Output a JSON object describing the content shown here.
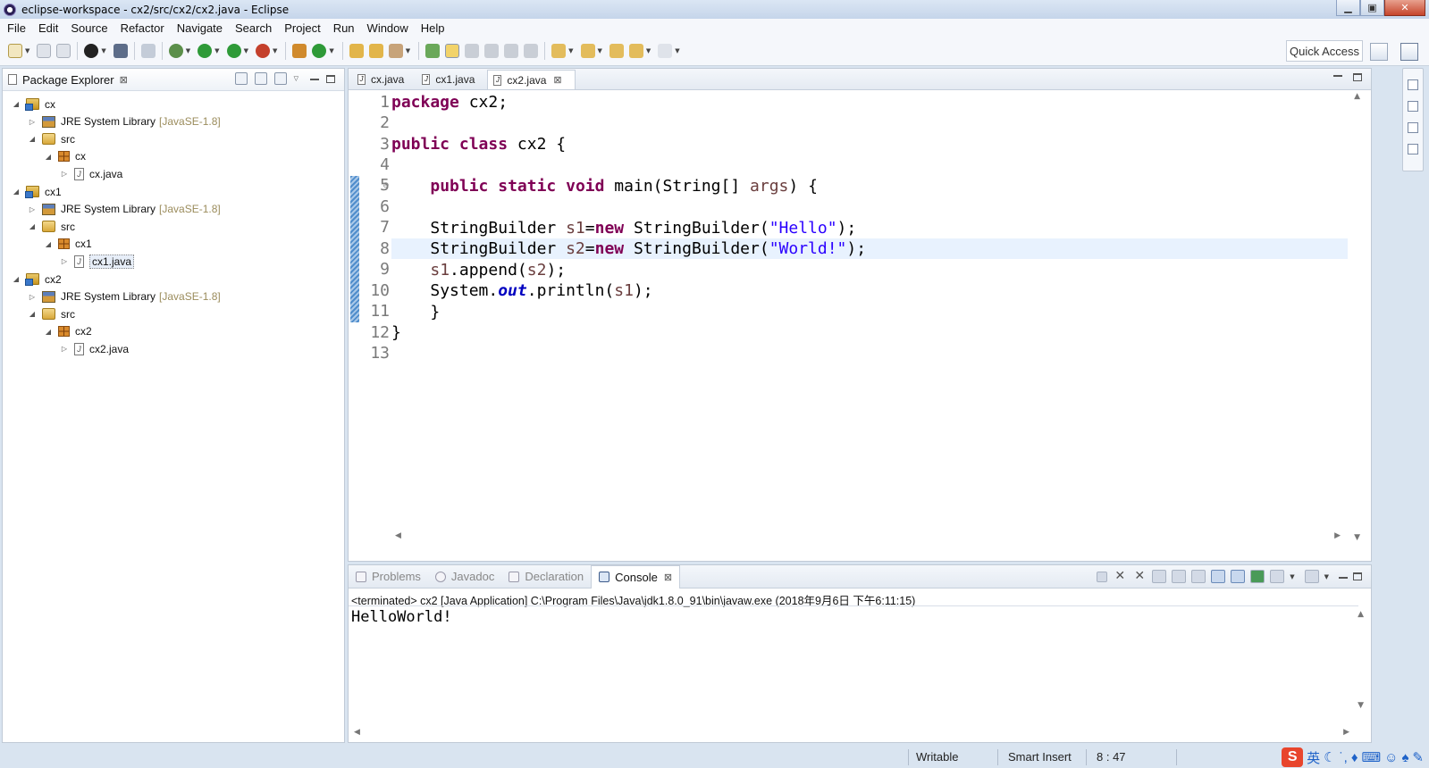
{
  "window": {
    "title": "eclipse-workspace - cx2/src/cx2/cx2.java - Eclipse",
    "minimize": "▁",
    "maximize": "▣",
    "close": "✕"
  },
  "menu": [
    "File",
    "Edit",
    "Source",
    "Refactor",
    "Navigate",
    "Search",
    "Project",
    "Run",
    "Window",
    "Help"
  ],
  "toolbar": {
    "quick_access": "Quick Access"
  },
  "package_explorer": {
    "title": "Package Explorer",
    "close": "⊠",
    "tree": [
      {
        "label": "cx",
        "type": "project",
        "level": 0,
        "expanded": true
      },
      {
        "label": "JRE System Library",
        "version": "[JavaSE-1.8]",
        "type": "library",
        "level": 1,
        "expanded": false
      },
      {
        "label": "src",
        "type": "src",
        "level": 1,
        "expanded": true
      },
      {
        "label": "cx",
        "type": "package",
        "level": 2,
        "expanded": true
      },
      {
        "label": "cx.java",
        "type": "java",
        "level": 3,
        "expanded": false
      },
      {
        "label": "cx1",
        "type": "project",
        "level": 0,
        "expanded": true
      },
      {
        "label": "JRE System Library",
        "version": "[JavaSE-1.8]",
        "type": "library",
        "level": 1,
        "expanded": false
      },
      {
        "label": "src",
        "type": "src",
        "level": 1,
        "expanded": true
      },
      {
        "label": "cx1",
        "type": "package",
        "level": 2,
        "expanded": true
      },
      {
        "label": "cx1.java",
        "type": "java",
        "level": 3,
        "expanded": false,
        "selected": true
      },
      {
        "label": "cx2",
        "type": "project",
        "level": 0,
        "expanded": true
      },
      {
        "label": "JRE System Library",
        "version": "[JavaSE-1.8]",
        "type": "library",
        "level": 1,
        "expanded": false
      },
      {
        "label": "src",
        "type": "src",
        "level": 1,
        "expanded": true
      },
      {
        "label": "cx2",
        "type": "package",
        "level": 2,
        "expanded": true
      },
      {
        "label": "cx2.java",
        "type": "java",
        "level": 3,
        "expanded": false
      }
    ]
  },
  "editor": {
    "tabs": [
      {
        "label": "cx.java",
        "active": false
      },
      {
        "label": "cx1.java",
        "active": false
      },
      {
        "label": "cx2.java",
        "active": true
      }
    ],
    "tab_close": "⊠",
    "line_numbers": [
      "1",
      "2",
      "3",
      "4",
      "5",
      "6",
      "7",
      "8",
      "9",
      "10",
      "11",
      "12",
      "13"
    ],
    "current_line": 8,
    "code": {
      "l1_kw": "package",
      "l1_rest": " cx2;",
      "l3_kw1": "public",
      "l3_kw2": "class",
      "l3_rest": " cx2 {",
      "l5_kw1": "public",
      "l5_kw2": "static",
      "l5_kw3": "void",
      "l5_rest1": " main(String[] ",
      "l5_var": "args",
      "l5_rest2": ") {",
      "l7_a": "StringBuilder ",
      "l7_var": "s1",
      "l7_b": "=",
      "l7_kw": "new",
      "l7_c": " StringBuilder(",
      "l7_str": "\"Hello\"",
      "l7_d": ");",
      "l8_a": "StringBuilder ",
      "l8_var": "s2",
      "l8_b": "=",
      "l8_kw": "new",
      "l8_c": " StringBuilder(",
      "l8_str": "\"World!\"",
      "l8_d": ");",
      "l9_var1": "s1",
      "l9_a": ".append(",
      "l9_var2": "s2",
      "l9_b": ");",
      "l10_a": "System.",
      "l10_fld": "out",
      "l10_b": ".println(",
      "l10_var": "s1",
      "l10_c": ");",
      "l11": "}",
      "l12": "}"
    }
  },
  "console": {
    "tabs": [
      {
        "label": "Problems",
        "active": false
      },
      {
        "label": "Javadoc",
        "active": false
      },
      {
        "label": "Declaration",
        "active": false
      },
      {
        "label": "Console",
        "active": true
      }
    ],
    "tab_close": "⊠",
    "terminated": "<terminated> cx2 [Java Application] C:\\Program Files\\Java\\jdk1.8.0_91\\bin\\javaw.exe (2018年9月6日 下午6:11:15)",
    "output": "HelloWorld!"
  },
  "status": {
    "writable": "Writable",
    "insert_mode": "Smart Insert",
    "position": "8 : 47",
    "ime_logo": "S",
    "ime_lang": "英"
  },
  "colors": {
    "keyword": "#7f0055",
    "string": "#2a00ff",
    "local_var": "#6a3e3e",
    "static_field": "#0000c0",
    "current_line_bg": "#e8f2fe"
  }
}
